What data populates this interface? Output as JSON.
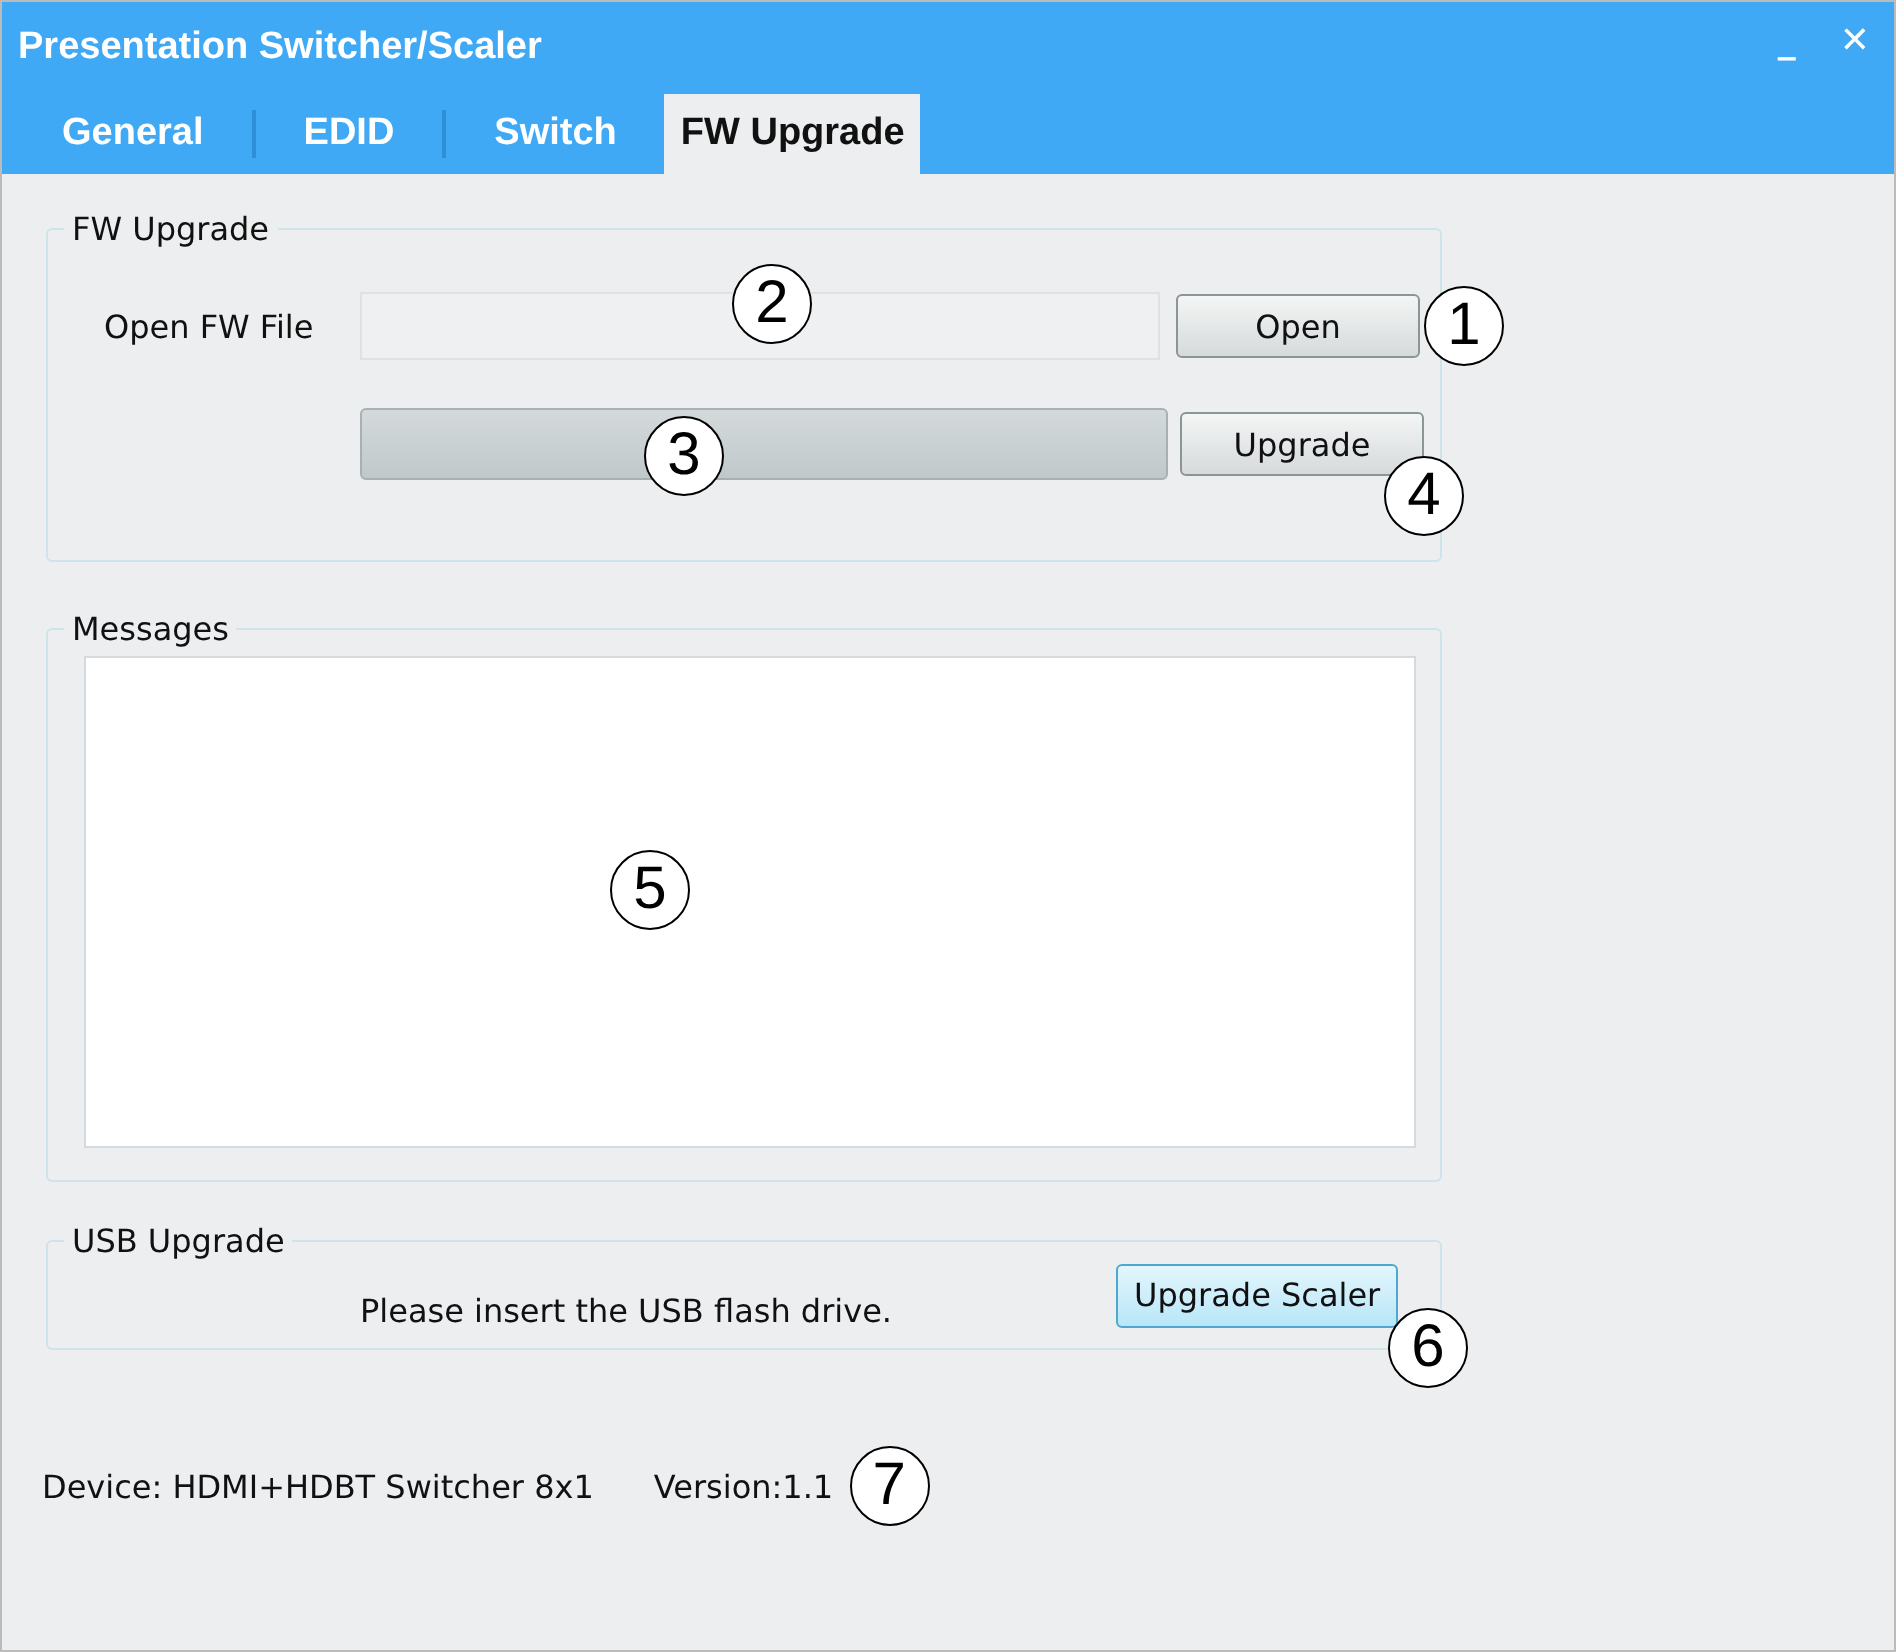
{
  "window": {
    "title": "Presentation Switcher/Scaler",
    "controls": [
      "_",
      "✕"
    ]
  },
  "tabs": [
    {
      "label": "General",
      "selected": false
    },
    {
      "label": "EDID",
      "selected": false
    },
    {
      "label": "Switch",
      "selected": false
    },
    {
      "label": "FW Upgrade",
      "selected": true
    }
  ],
  "fw_upgrade": {
    "title": "FW Upgrade",
    "file_label": "Open FW File",
    "file_field": {
      "callout": "2"
    },
    "open_button": {
      "label": "Open",
      "callout": "1"
    },
    "progress": {
      "level": 0,
      "callout": "3"
    },
    "upgrade_button": {
      "label": "Upgrade",
      "callout": "4"
    }
  },
  "messages": {
    "title": "Messages",
    "callout": "5"
  },
  "usb_upgrade": {
    "title": "USB Upgrade",
    "message": "Please insert the USB flash drive.",
    "button": {
      "label": "Upgrade Scaler",
      "callout": "6"
    }
  },
  "status": {
    "device": "Device: HDMI+HDBT Switcher 8x1",
    "version": "Version:1.1",
    "callout": "7"
  }
}
